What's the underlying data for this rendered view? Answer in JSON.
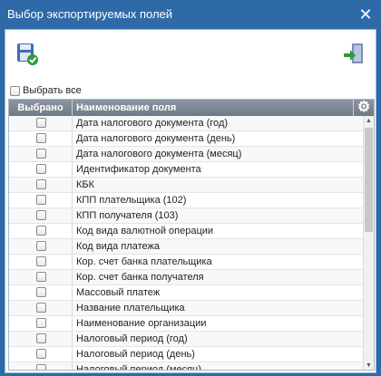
{
  "window": {
    "title": "Выбор экспортируемых полей",
    "close_glyph": "✕"
  },
  "toolbar": {
    "save_icon": "save-icon",
    "exit_icon": "exit-icon"
  },
  "select_all": {
    "label": "Выбрать все",
    "checked": false
  },
  "grid": {
    "columns": [
      "Выбрано",
      "Наименование поля"
    ],
    "settings_icon": "gear-icon",
    "rows": [
      "Дата налогового документа (год)",
      "Дата налогового документа (день)",
      "Дата налогового документа (месяц)",
      "Идентификатор документа",
      "КБК",
      "КПП плательщика (102)",
      "КПП получателя (103)",
      "Код вида валютной операции",
      "Код вида платежа",
      "Кор. счет банка плательщика",
      "Кор. счет банка получателя",
      "Массовый платеж",
      "Название плательщика",
      "Наименование организации",
      "Налоговый период (год)",
      "Налоговый период (день)",
      "Налоговый период (месяц)"
    ]
  },
  "scrollbar": {
    "position_fraction": 0.0
  }
}
